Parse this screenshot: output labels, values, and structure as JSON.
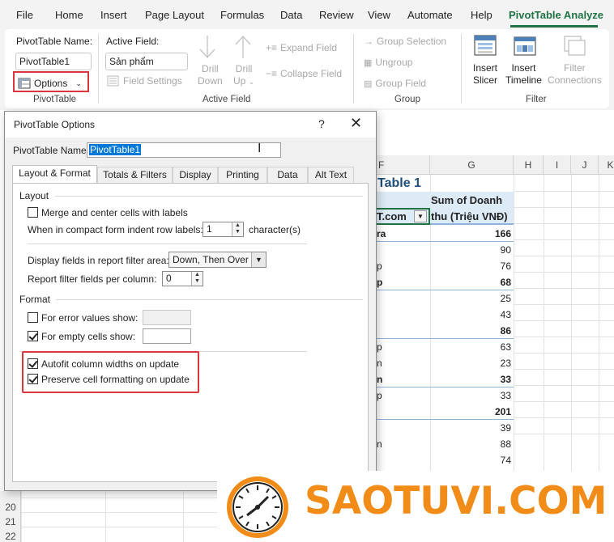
{
  "menu": {
    "items": [
      "File",
      "Home",
      "Insert",
      "Page Layout",
      "Formulas",
      "Data",
      "Review",
      "View",
      "Automate",
      "Help",
      "PivotTable Analyze"
    ]
  },
  "ribbon": {
    "pivottable_name_label": "PivotTable Name:",
    "pivottable_name_value": "PivotTable1",
    "options_label": "Options",
    "pivottable_group": "PivotTable",
    "active_field_label": "Active Field:",
    "active_field_value": "Sản phẩm",
    "field_settings": "Field Settings",
    "drill_down": [
      "Drill",
      "Down"
    ],
    "drill_up": [
      "Drill",
      "Up"
    ],
    "expand_field": "Expand Field",
    "collapse_field": "Collapse Field",
    "active_field_group": "Active Field",
    "group_selection": "Group Selection",
    "ungroup": "Ungroup",
    "group_field": "Group Field",
    "group_group": "Group",
    "insert_slicer": [
      "Insert",
      "Slicer"
    ],
    "insert_timeline": [
      "Insert",
      "Timeline"
    ],
    "filter_connections": [
      "Filter",
      "Connections"
    ],
    "filter_group": "Filter"
  },
  "sheet": {
    "columns": [
      "F",
      "G",
      "H",
      "I",
      "J",
      "K"
    ],
    "pivot_title": "Table 1",
    "header_col1": "T.com",
    "header_col2_line1": "Sum of Doanh",
    "header_col2_line2": "thu (Triệu VNĐ)",
    "rows": [
      {
        "label": "ra",
        "value": "166",
        "bold": true
      },
      {
        "label": "",
        "value": "90",
        "bold": false
      },
      {
        "label": "p",
        "value": "76",
        "bold": false
      },
      {
        "label": "p",
        "value": "68",
        "bold": true
      },
      {
        "label": "",
        "value": "25",
        "bold": false
      },
      {
        "label": "",
        "value": "43",
        "bold": false
      },
      {
        "label": "",
        "value": "86",
        "bold": true
      },
      {
        "label": "p",
        "value": "63",
        "bold": false
      },
      {
        "label": "n",
        "value": "23",
        "bold": false
      },
      {
        "label": "n",
        "value": "33",
        "bold": true
      },
      {
        "label": "p",
        "value": "33",
        "bold": false
      },
      {
        "label": "",
        "value": "201",
        "bold": true
      },
      {
        "label": "",
        "value": "39",
        "bold": false
      },
      {
        "label": "n",
        "value": "88",
        "bold": false
      },
      {
        "label": "",
        "value": "74",
        "bold": false
      }
    ],
    "row_numbers": [
      "20",
      "21",
      "22"
    ]
  },
  "dialog": {
    "title": "PivotTable Options",
    "help": "?",
    "close": "✕",
    "name_label": "PivotTable Name:",
    "name_value": "PivotTable1",
    "tabs": [
      "Layout & Format",
      "Totals & Filters",
      "Display",
      "Printing",
      "Data",
      "Alt Text"
    ],
    "layout_heading": "Layout",
    "merge_center": "Merge and center cells with labels",
    "indent_label": "When in compact form indent row labels:",
    "indent_value": "1",
    "indent_unit": "character(s)",
    "display_fields_label": "Display fields in report filter area:",
    "display_fields_value": "Down, Then Over",
    "report_filter_label": "Report filter fields per column:",
    "report_filter_value": "0",
    "format_heading": "Format",
    "error_values": "For error values show:",
    "empty_cells": "For empty cells show:",
    "autofit": "Autofit column widths on update",
    "preserve": "Preserve cell formatting on update"
  },
  "logo": {
    "text": "SAOTUVI.COM",
    "color": "#f28c18"
  },
  "colors": {
    "excel_green": "#217346",
    "highlight_red": "#d9363e",
    "pivot_header_bg": "#ddebf7",
    "pivot_title_color": "#1f4e79"
  }
}
